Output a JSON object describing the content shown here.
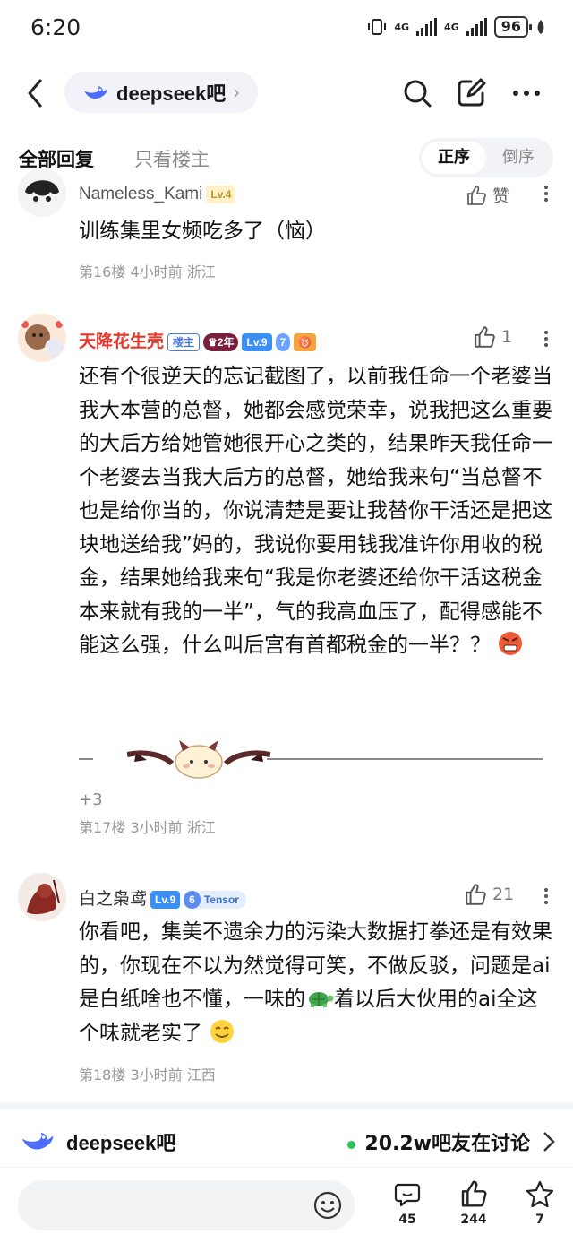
{
  "status_bar": {
    "time": "6:20",
    "network1": "4G",
    "network2": "4G",
    "battery": "96"
  },
  "header": {
    "forum_name": "deepseek吧",
    "chevron": "›"
  },
  "tabs": {
    "all_replies": "全部回复",
    "only_op": "只看楼主",
    "order_asc": "正序",
    "order_desc": "倒序"
  },
  "comments": [
    {
      "username": "Nameless_Kami",
      "level": "Lv.4",
      "like_label": "赞",
      "text": "训练集里女频吃多了（恼）",
      "floor": "第16楼",
      "time": "4小时前",
      "location": "浙江"
    },
    {
      "username": "天降花生壳",
      "op_badge": "楼主",
      "years_badge": "2年",
      "level": "Lv.9",
      "member_level": "7",
      "likes": "1",
      "text": "还有个很逆天的忘记截图了，以前我任命一个老婆当我大本营的总督，她都会感觉荣幸，说我把这么重要的大后方给她管她很开心之类的，结果昨天我任命一个老婆去当我大后方的总督，她给我来句“当总督不也是给你当的，你说清楚是要让我替你干活还是把这块地送给我”妈的，我说你要用钱我准许你用收的税金，结果她给我来句“我是你老婆还给你干活这税金本来就有我的一半”，气的我高血压了，配得感能不能这么强，什么叫后宫有首都税金的一半？？",
      "more_count": "+3",
      "floor": "第17楼",
      "time": "3小时前",
      "location": "浙江"
    },
    {
      "username": "白之枭鸢",
      "level": "Lv.9",
      "member_level": "6",
      "badge_text": "Tensor",
      "likes": "21",
      "text": "你看吧，集美不遗余力的污染大数据打拳还是有效果的，你现在不以为然觉得可笑，不做反驳，问题是ai是白纸啥也不懂，一味的",
      "text2": "着以后大伙用的ai全这个味就老实了",
      "floor": "第18楼",
      "time": "3小时前",
      "location": "江西"
    }
  ],
  "forum_bar": {
    "name": "deepseek吧",
    "stat": "20.2w吧友在讨论"
  },
  "bottom_bar": {
    "comments": "45",
    "likes": "244",
    "favorites": "7"
  }
}
